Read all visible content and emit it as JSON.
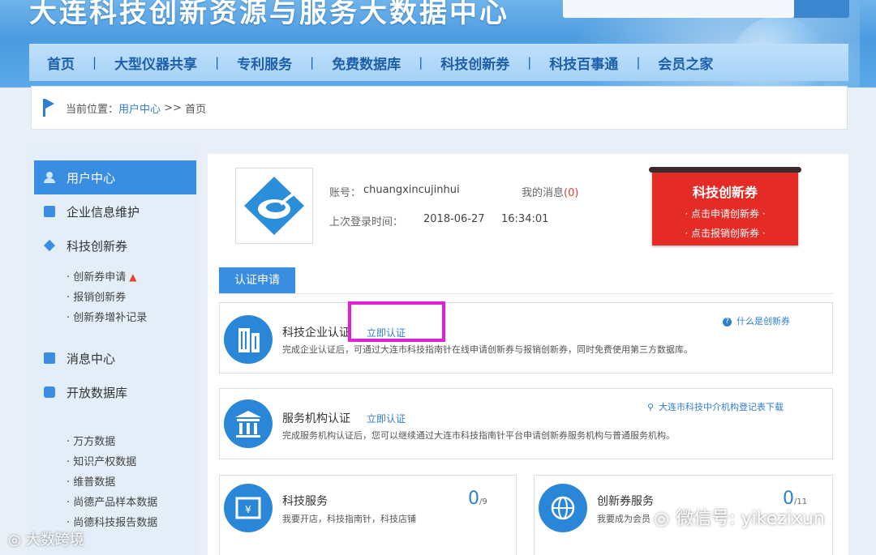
{
  "header": {
    "site_title": "大连科技创新资源与服务大数据中心",
    "nav": [
      "首页",
      "大型仪器共享",
      "专利服务",
      "免费数据库",
      "科技创新券",
      "科技百事通",
      "会员之家"
    ]
  },
  "breadcrumb": {
    "prefix": "当前位置：",
    "link": "用户中心",
    "sep": " >> ",
    "current": "首页"
  },
  "sidebar": {
    "items": [
      {
        "label": "用户中心",
        "icon": "user-icon",
        "active": true
      },
      {
        "label": "企业信息维护",
        "icon": "document-icon"
      },
      {
        "label": "科技创新券",
        "icon": "diamond-icon"
      }
    ],
    "voucher_sub": [
      {
        "label": "· 创新券申请",
        "hot": true
      },
      {
        "label": "· 报销创新券"
      },
      {
        "label": "· 创新券增补记录"
      }
    ],
    "items2": [
      {
        "label": "消息中心",
        "icon": "message-icon"
      },
      {
        "label": "开放数据库",
        "icon": "database-icon"
      }
    ],
    "db_sub": [
      "· 万方数据",
      "· 知识产权数据",
      "· 维普数据",
      "· 尚德产品样本数据",
      "· 尚德科技报告数据"
    ]
  },
  "profile": {
    "account_label": "账号：",
    "account": "chuangxincujinhui",
    "messages_label": "我的消息",
    "messages_count": "(0)",
    "last_login_label": "上次登录时间：",
    "last_login_date": "2018-06-27",
    "last_login_time": "16:34:01"
  },
  "promo": {
    "title": "科技创新券",
    "link1": "· 点击申请创新券 ·",
    "link2": "· 点击报销创新券 ·"
  },
  "cert_tab": "认证申请",
  "cards": {
    "enterprise": {
      "title": "科技企业认证",
      "action": "立即认证",
      "desc": "完成企业认证后，可通过大连市科技指南针在线申请创新券与报销创新券，同时免费使用第三方数据库。",
      "help": "什么是创新券"
    },
    "agency": {
      "title": "服务机构认证",
      "action": "立即认证",
      "desc": "完成服务机构认证后，您可以继续通过大连市科技指南针平台申请创新券服务机构与普通服务机构。",
      "help": "大连市科技中介机构登记表下载"
    },
    "tech_service": {
      "title": "科技服务",
      "desc": "我要开店，科技指南针，科技店铺",
      "count": "0",
      "total": "/9"
    },
    "voucher_service": {
      "title": "创新券服务",
      "desc": "我要成为会员",
      "count": "0",
      "total": "/11"
    }
  },
  "watermarks": {
    "left": "大数跨境",
    "right": "微信号: yikezixun"
  },
  "colors": {
    "accent": "#3a8ee1",
    "promo_red": "#e52b26",
    "highlight": "#e51fd5"
  }
}
